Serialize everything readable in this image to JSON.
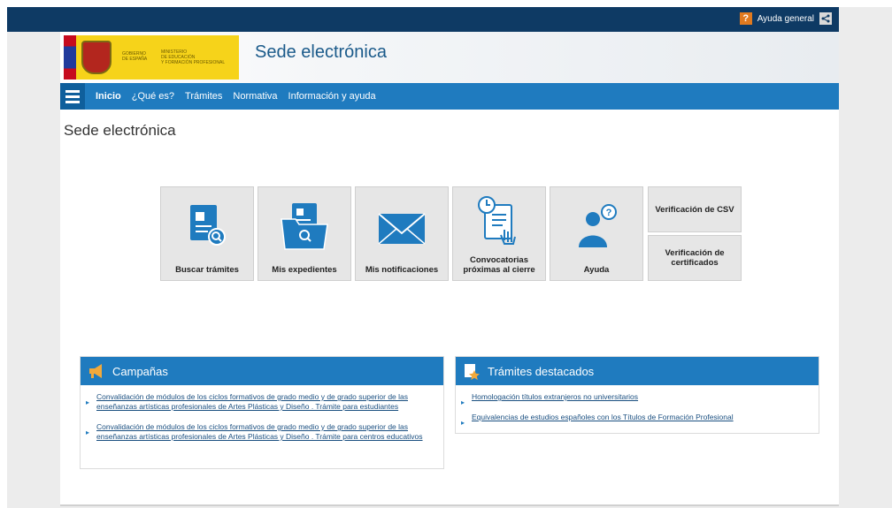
{
  "topbar": {
    "help_label": "Ayuda general"
  },
  "header": {
    "gov_line1": "GOBIERNO",
    "gov_line2": "DE ESPAÑA",
    "ministry_line1": "MINISTERIO",
    "ministry_line2": "DE EDUCACIÓN",
    "ministry_line3": "Y FORMACIÓN PROFESIONAL",
    "site_title": "Sede electrónica"
  },
  "nav": [
    "Inicio",
    "¿Qué es?",
    "Trámites",
    "Normativa",
    "Información y ayuda"
  ],
  "page_title": "Sede electrónica",
  "tiles": [
    {
      "label": "Buscar trámites",
      "icon": "document-search-icon"
    },
    {
      "label": "Mis expedientes",
      "icon": "folder-search-icon"
    },
    {
      "label": "Mis notificaciones",
      "icon": "envelope-icon"
    },
    {
      "label": "Convocatorias próximas al cierre",
      "icon": "clock-document-icon"
    },
    {
      "label": "Ayuda",
      "icon": "user-help-icon"
    }
  ],
  "side_tiles": [
    "Verificación de CSV",
    "Verificación de certificados"
  ],
  "campaigns": {
    "title": "Campañas",
    "items": [
      "Convalidación de módulos de los ciclos formativos de grado medio y de grado superior de las enseñanzas artísticas profesionales de Artes Plásticas y Diseño . Trámite para estudiantes",
      "Convalidación de módulos de los ciclos formativos de grado medio y de grado superior de las enseñanzas artísticas profesionales de Artes Plásticas y Diseño . Trámite para centros educativos"
    ]
  },
  "featured": {
    "title": "Trámites destacados",
    "items": [
      "Homologación títulos extranjeros no universitarios",
      "Equivalencias de estudios españoles con los Títulos de Formación Profesional"
    ]
  },
  "colors": {
    "nav_blue": "#1f7bbf",
    "top_dark": "#0e3a64",
    "brand_yellow": "#f6d31a",
    "icon_blue": "#1f7bbf"
  }
}
